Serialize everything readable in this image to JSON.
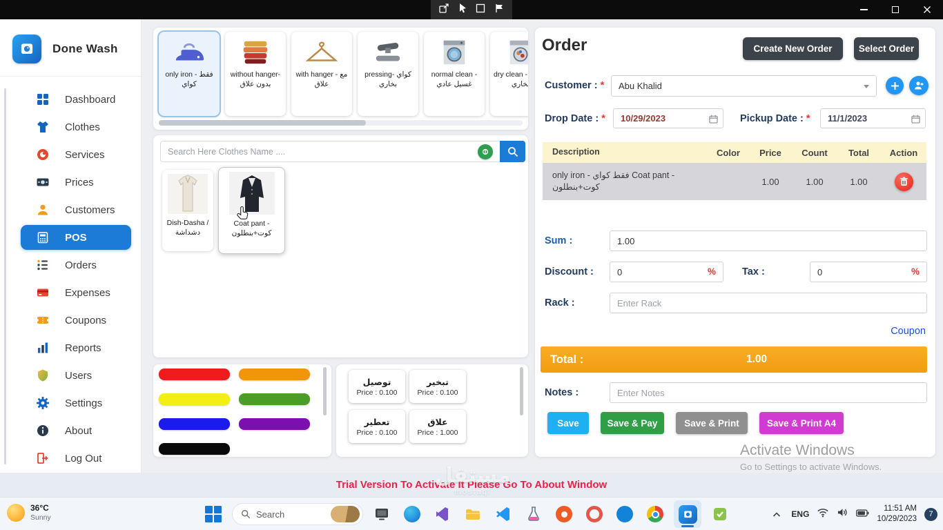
{
  "theme": {
    "primary_blue": "#1d7bd8",
    "sidebar_active_bg": "#1d7bd8",
    "table_header_bg": "#fcf4cd",
    "table_row_selected_bg": "#d6d6da",
    "total_bar_orange": "#f6a21d",
    "save_blue": "#1fb0f2",
    "save_pay_green": "#2f9e47",
    "save_print_gray": "#909090",
    "save_print_a4_magenta": "#d23bd2",
    "danger_red": "#e53935",
    "trial_text_red": "#e8234a"
  },
  "sidebar": {
    "app_name": "Done Wash",
    "items": [
      {
        "label": "Dashboard"
      },
      {
        "label": "Clothes"
      },
      {
        "label": "Services"
      },
      {
        "label": "Prices"
      },
      {
        "label": "Customers"
      },
      {
        "label": "POS",
        "active": true
      },
      {
        "label": "Orders"
      },
      {
        "label": "Expenses"
      },
      {
        "label": "Coupons"
      },
      {
        "label": "Reports"
      },
      {
        "label": "Users"
      },
      {
        "label": "Settings"
      },
      {
        "label": "About"
      },
      {
        "label": "Log Out"
      }
    ]
  },
  "services": [
    {
      "label": "only iron - فقط كواي",
      "selected": true
    },
    {
      "label": "without hanger- بدون علاق"
    },
    {
      "label": "with hanger - مع علاق"
    },
    {
      "label": "pressing- كواي بخاري"
    },
    {
      "label": "normal clean - غسيل عادي"
    },
    {
      "label": "dry clean - غسيل بخاري"
    }
  ],
  "search": {
    "placeholder": "Search Here Clothes Name ...."
  },
  "products": [
    {
      "label": "Dish-Dasha / دشداشة"
    },
    {
      "label": "Coat pant - كوت+بنطلون"
    }
  ],
  "palette": [
    "#ee1c1c",
    "#f0950c",
    "#f3ee14",
    "#4a9e28",
    "#1b1bee",
    "#7c0fb0",
    "#0a0a0a"
  ],
  "extras": [
    {
      "name": "توصيل",
      "price": "Price : 0.100"
    },
    {
      "name": "تبخير",
      "price": "Price : 0.100"
    },
    {
      "name": "تعطير",
      "price": "Price : 0.100"
    },
    {
      "name": "علاق",
      "price": "Price : 1.000"
    }
  ],
  "order": {
    "title": "Order",
    "create_new_order": "Create New Order",
    "select_order": "Select Order",
    "required_mark": "*",
    "customer_label": "Customer :",
    "customer_value": "Abu Khalid",
    "drop_date_label": "Drop Date :",
    "drop_date_value": "10/29/2023",
    "pickup_date_label": "Pickup Date :",
    "pickup_date_value": "11/1/2023",
    "table": {
      "headers": {
        "description": "Description",
        "color": "Color",
        "price": "Price",
        "count": "Count",
        "total": "Total",
        "action": "Action"
      },
      "row": {
        "description": "only iron - فقط كواي Coat pant - كوت+بنطلون",
        "color": "",
        "price": "1.00",
        "count": "1.00",
        "total": "1.00"
      }
    },
    "sum_label": "Sum :",
    "sum_value": "1.00",
    "discount_label": "Discount :",
    "discount_value": "0",
    "discount_unit": "%",
    "tax_label": "Tax :",
    "tax_value": "0",
    "tax_unit": "%",
    "rack_label": "Rack :",
    "rack_placeholder": "Enter Rack",
    "coupon_link": "Coupon",
    "total_label": "Total :",
    "total_value": "1.00",
    "notes_label": "Notes :",
    "notes_placeholder": "Enter Notes",
    "save": "Save",
    "save_pay": "Save & Pay",
    "save_print": "Save & Print",
    "save_print_a4": "Save & Print A4"
  },
  "activate": {
    "line1": "Activate Windows",
    "line2": "Go to Settings to activate Windows."
  },
  "trial_notice": "Trial Version To Activate It Please Go To About Window",
  "site_watermark": {
    "arabic": "مستقل",
    "latin": "mostaql"
  },
  "taskbar": {
    "weather_temp": "36°C",
    "weather_condition": "Sunny",
    "search_placeholder": "Search",
    "language": "ENG",
    "time": "11:51 AM",
    "date": "10/29/2023",
    "notification_count": "7"
  }
}
